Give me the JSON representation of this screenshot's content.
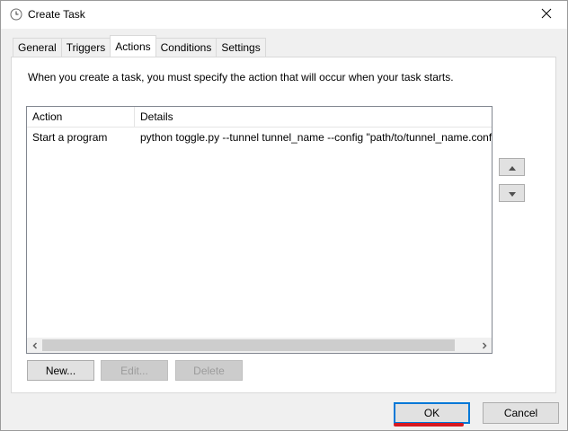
{
  "window": {
    "title": "Create Task"
  },
  "tabs": [
    {
      "label": "General",
      "active": false
    },
    {
      "label": "Triggers",
      "active": false
    },
    {
      "label": "Actions",
      "active": true
    },
    {
      "label": "Conditions",
      "active": false
    },
    {
      "label": "Settings",
      "active": false
    }
  ],
  "actions_panel": {
    "description": "When you create a task, you must specify the action that will occur when your task starts.",
    "columns": [
      "Action",
      "Details"
    ],
    "rows": [
      {
        "action": "Start a program",
        "details": "python toggle.py --tunnel tunnel_name --config \"path/to/tunnel_name.conf\""
      }
    ],
    "scroll": {
      "thumb_fraction": 0.95
    },
    "buttons": {
      "new": "New...",
      "edit": "Edit...",
      "delete": "Delete"
    }
  },
  "footer": {
    "ok": "OK",
    "cancel": "Cancel"
  },
  "icons": {
    "title": "clock-icon",
    "close": "close-icon",
    "up": "arrow-up-icon",
    "down": "arrow-down-icon"
  },
  "colors": {
    "default_button_border": "#0078d7",
    "annotation": "#d71920"
  }
}
